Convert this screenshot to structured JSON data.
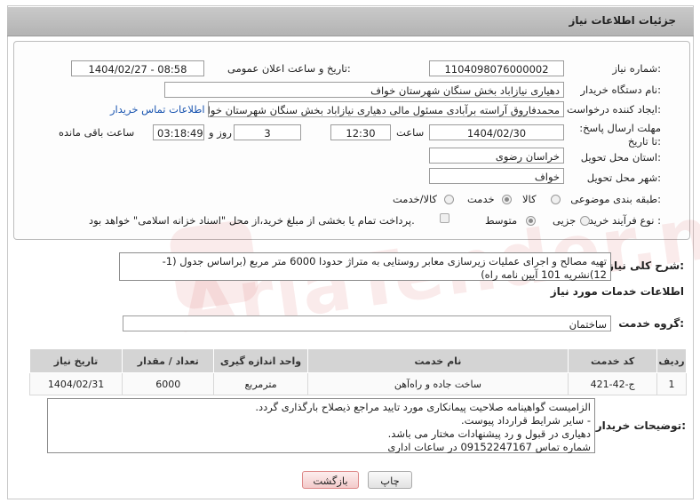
{
  "header": {
    "title": "جزئیات اطلاعات نیاز"
  },
  "labels": {
    "need_number": "شماره نیاز:",
    "announce_datetime": "تاریخ و ساعت اعلان عمومی:",
    "buyer_org": "نام دستگاه خریدار:",
    "requester": "ایجاد کننده درخواست:",
    "send_deadline": "مهلت ارسال پاسخ: تا تاریخ:",
    "hour": "ساعت",
    "day_and": "روز و",
    "remaining": "ساعت باقی مانده",
    "province": "استان محل تحویل:",
    "city": "شهر محل تحویل:",
    "category": "طبقه بندی موضوعی:",
    "process_type": "نوع فرآیند خرید :",
    "summary": "شرح کلی نیاز:",
    "services_info": "اطلاعات خدمات مورد نیاز",
    "service_group": "گروه خدمت:",
    "buyer_notes": "توضیحات خریدار:"
  },
  "fields": {
    "need_number": "1104098076000002",
    "announce_datetime": "1404/02/27 - 08:58",
    "buyer_org": "دهیاری نیازاباد بخش سنگان شهرستان خواف",
    "requester": "محمدفاروق آراسته برآبادی مسئول مالی دهیاری نیازاباد بخش سنگان شهرستان خواف",
    "contact_link": "اطلاعات تماس خریدار",
    "deadline_date": "1404/02/30",
    "deadline_time": "12:30",
    "days": "3",
    "remaining_time": "03:18:49",
    "province": "خراسان رضوی",
    "city": "خواف"
  },
  "category_options": [
    {
      "label": "کالا",
      "selected": false
    },
    {
      "label": "خدمت",
      "selected": true
    },
    {
      "label": "کالا/خدمت",
      "selected": false
    }
  ],
  "process_options": [
    {
      "label": "جزیی",
      "selected": false
    },
    {
      "label": "متوسط",
      "selected": true
    }
  ],
  "payment_note": "پرداخت تمام یا بخشی از مبلغ خرید،از محل \"اسناد خزانه اسلامی\" خواهد بود.",
  "summary_text": "تهیه مصالح و اجرای عملیات زیرسازی معابر روستایی به متراژ حدودا 6000 متر مربع (براساس جدول (1-12)نشریه 101 آیین نامه راه)",
  "service_group_value": "ساختمان",
  "table": {
    "headers": [
      "ردیف",
      "کد خدمت",
      "نام خدمت",
      "واحد اندازه گیری",
      "تعداد / مقدار",
      "تاریخ نیاز"
    ],
    "rows": [
      [
        "1",
        "ج-42-421",
        "ساخت جاده و راه‌آهن",
        "مترمربع",
        "6000",
        "1404/02/31"
      ]
    ]
  },
  "notes_lines": [
    "الزامیست گواهینامه صلاحیت پیمانکاری مورد تایید مراجع ذیصلاح بارگذاری گردد.",
    "- سایر شرایط قرارداد پیوست.",
    "دهیاری در قبول و رد پیشنهادات مختار می باشد.",
    "شماره تماس 09152247167 در ساعات اداری"
  ],
  "buttons": {
    "print": "چاپ",
    "back": "بازگشت"
  },
  "colors": {
    "link": "#1a55b0",
    "header_bg": "#bcbcbc",
    "back_button": "#f3caca"
  }
}
